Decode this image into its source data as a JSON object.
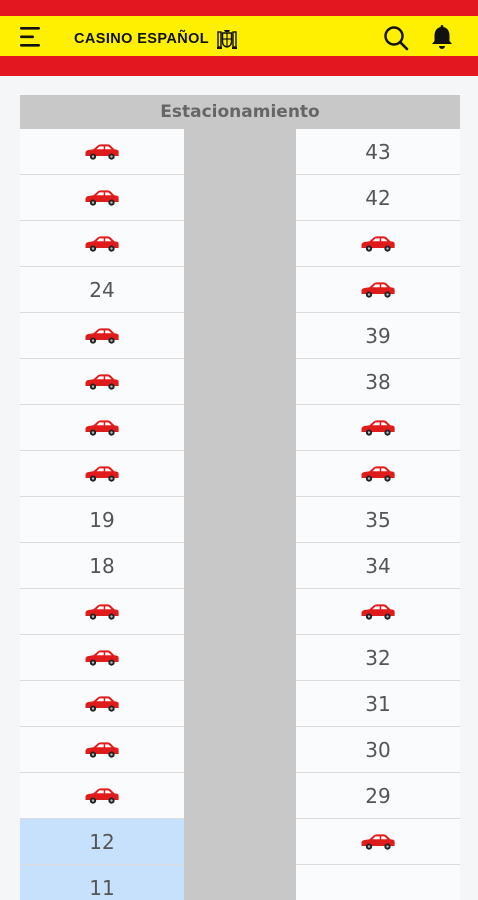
{
  "header": {
    "brand": "CASINO ESPAÑOL",
    "icons": {
      "menu": "menu-icon",
      "crest": "crest-icon",
      "search": "search-icon",
      "notifications": "bell-icon"
    },
    "colors": {
      "red": "#e2171f",
      "yellow": "#ffef00"
    }
  },
  "parking": {
    "title": "Estacionamiento",
    "left_spots": [
      {
        "label": "",
        "occupied": true
      },
      {
        "label": "",
        "occupied": true
      },
      {
        "label": "",
        "occupied": true
      },
      {
        "label": "24",
        "occupied": false
      },
      {
        "label": "",
        "occupied": true
      },
      {
        "label": "",
        "occupied": true
      },
      {
        "label": "",
        "occupied": true
      },
      {
        "label": "",
        "occupied": true
      },
      {
        "label": "19",
        "occupied": false
      },
      {
        "label": "18",
        "occupied": false
      },
      {
        "label": "",
        "occupied": true
      },
      {
        "label": "",
        "occupied": true
      },
      {
        "label": "",
        "occupied": true
      },
      {
        "label": "",
        "occupied": true
      },
      {
        "label": "",
        "occupied": true
      },
      {
        "label": "12",
        "occupied": false,
        "selected": true
      },
      {
        "label": "11",
        "occupied": false,
        "selected": true
      }
    ],
    "right_spots": [
      {
        "label": "43",
        "occupied": false
      },
      {
        "label": "42",
        "occupied": false
      },
      {
        "label": "",
        "occupied": true
      },
      {
        "label": "",
        "occupied": true
      },
      {
        "label": "39",
        "occupied": false
      },
      {
        "label": "38",
        "occupied": false
      },
      {
        "label": "",
        "occupied": true
      },
      {
        "label": "",
        "occupied": true
      },
      {
        "label": "35",
        "occupied": false
      },
      {
        "label": "34",
        "occupied": false
      },
      {
        "label": "",
        "occupied": true
      },
      {
        "label": "32",
        "occupied": false
      },
      {
        "label": "31",
        "occupied": false
      },
      {
        "label": "30",
        "occupied": false
      },
      {
        "label": "29",
        "occupied": false
      },
      {
        "label": "",
        "occupied": true
      },
      {
        "label": "",
        "occupied": false
      }
    ],
    "occupied_icon": "car-icon",
    "colors": {
      "car": "#e01b1b",
      "selected": "#c7e1fd",
      "aisle": "#c8c8c8"
    }
  }
}
